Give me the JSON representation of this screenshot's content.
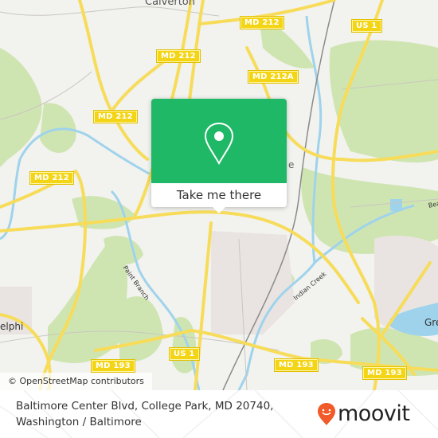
{
  "map": {
    "attribution": "© OpenStreetMap contributors",
    "places": [
      {
        "name": "Calverton",
        "id": "calverton"
      },
      {
        "name": "elphi",
        "id": "adelphi-partial"
      },
      {
        "name": "Gre",
        "id": "greenbelt-partial"
      },
      {
        "name": "e",
        "id": "beltsville-partial"
      }
    ],
    "water_labels": [
      {
        "name": "Paint Branch",
        "id": "paint-branch"
      },
      {
        "name": "Indian Creek",
        "id": "indian-creek"
      },
      {
        "name": "Bea",
        "id": "beaverdam-partial"
      }
    ],
    "road_shields": [
      {
        "label": "MD 212",
        "id": "md212-a"
      },
      {
        "label": "MD 212",
        "id": "md212-b"
      },
      {
        "label": "MD 212",
        "id": "md212-c"
      },
      {
        "label": "MD 212",
        "id": "md212-d"
      },
      {
        "label": "MD 212A",
        "id": "md212a"
      },
      {
        "label": "US 1",
        "id": "us1-north"
      },
      {
        "label": "US 1",
        "id": "us1-south"
      },
      {
        "label": "MD 193",
        "id": "md193-a"
      },
      {
        "label": "MD 193",
        "id": "md193-b"
      },
      {
        "label": "MD 193",
        "id": "md193-c"
      }
    ],
    "colors": {
      "land": "#f2f2ef",
      "park": "#cfe5b1",
      "water": "#9fd3ec",
      "road": "#f7dc5a",
      "urban": "#e9e4e2"
    }
  },
  "popup": {
    "icon": "location-pin-icon",
    "button_label": "Take me there",
    "color": "#1fb866"
  },
  "footer": {
    "address_line1": "Baltimore Center Blvd, College Park, MD 20740,",
    "address_line2": "Washington / Baltimore",
    "logo_text": "moovit",
    "logo_color": "#f15a29"
  }
}
